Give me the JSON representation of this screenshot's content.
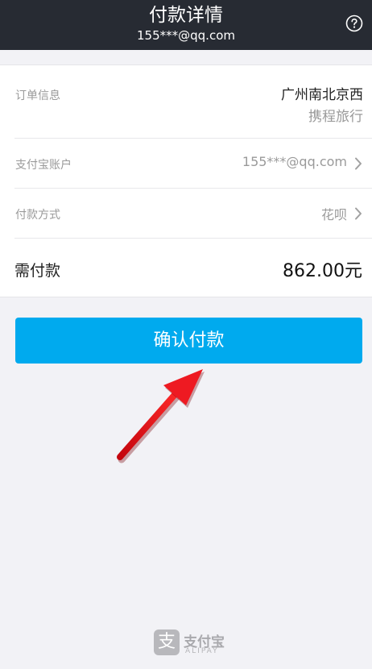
{
  "header": {
    "title": "付款详情",
    "subtitle": "155***@qq.com",
    "help_icon": "question-circle-icon"
  },
  "order": {
    "label": "订单信息",
    "line1": "广州南北京西",
    "line2": "携程旅行"
  },
  "account": {
    "label": "支付宝账户",
    "value": "155***@qq.com"
  },
  "method": {
    "label": "付款方式",
    "value": "花呗"
  },
  "due": {
    "label": "需付款",
    "value": "862.00元"
  },
  "confirm_button": "确认付款",
  "footer": {
    "logo_glyph": "支",
    "brand": "支付宝",
    "brand_sub": "ALIPAY"
  },
  "colors": {
    "header_bg": "#272b33",
    "accent": "#00aaee",
    "annotation_arrow": "#e8121b"
  }
}
